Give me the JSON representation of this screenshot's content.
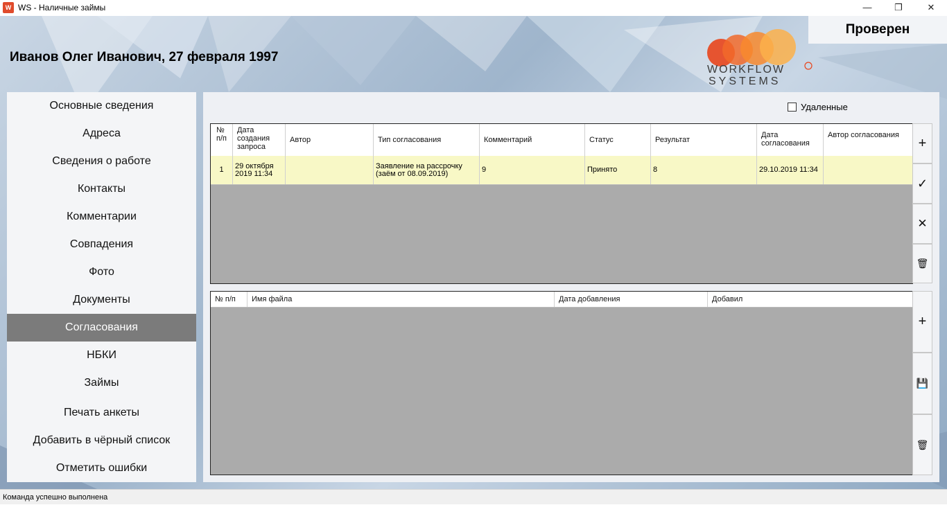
{
  "window": {
    "icon_text": "W",
    "title": "WS - Наличные займы",
    "minimize_glyph": "—",
    "maximize_glyph": "❐",
    "close_glyph": "✕"
  },
  "header": {
    "status": "Проверен",
    "person": "Иванов Олег Иванович, 27 февраля 1997",
    "logo_line1": "WORKFLOW",
    "logo_line2": "SYSTEMS"
  },
  "sidebar": {
    "items": [
      {
        "label": "Основные сведения"
      },
      {
        "label": "Адреса"
      },
      {
        "label": "Сведения о работе"
      },
      {
        "label": "Контакты"
      },
      {
        "label": "Комментарии"
      },
      {
        "label": "Совпадения"
      },
      {
        "label": "Фото"
      },
      {
        "label": "Документы"
      },
      {
        "label": "Согласования",
        "active": true
      },
      {
        "label": "НБКИ"
      },
      {
        "label": "Займы"
      },
      {
        "label": "Печать анкеты"
      },
      {
        "label": "Добавить в чёрный список"
      },
      {
        "label": "Отметить ошибки"
      }
    ]
  },
  "main": {
    "deleted_label": "Удаленные",
    "approvals": {
      "columns": [
        "№ п/п",
        "Дата создания запроса",
        "Автор",
        "Тип согласования",
        "Комментарий",
        "Статус",
        "Результат",
        "Дата согласования",
        "Автор согласования"
      ],
      "rows": [
        [
          "1",
          "29 октября 2019 11:34",
          "",
          "Заявление на рассрочку (заём от 08.09.2019)",
          "9",
          "Принято",
          "8",
          "29.10.2019 11:34",
          ""
        ]
      ],
      "buttons": [
        "+",
        "✓",
        "✕",
        "🗑"
      ]
    },
    "files": {
      "columns": [
        "№ п/п",
        "Имя файла",
        "Дата добавления",
        "Добавил"
      ],
      "rows": [],
      "buttons": [
        "+",
        "💾",
        "🗑"
      ]
    }
  },
  "statusbar": {
    "message": "Команда успешно выполнена"
  }
}
